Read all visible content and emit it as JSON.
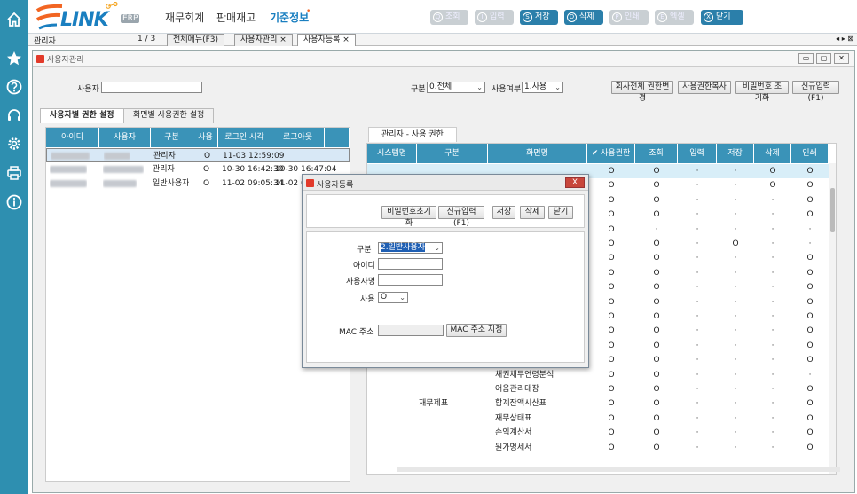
{
  "header": {
    "logo_text": "LINK",
    "logo_badge": "ERP",
    "menus": [
      "재무회계",
      "판매재고",
      "기준정보"
    ],
    "active_menu": "기준정보",
    "toolbar": [
      {
        "key": "Q",
        "label": "조회",
        "enabled": false
      },
      {
        "key": "I",
        "label": "입력",
        "enabled": false
      },
      {
        "key": "S",
        "label": "저장",
        "enabled": true
      },
      {
        "key": "D",
        "label": "삭제",
        "enabled": true
      },
      {
        "key": "P",
        "label": "인쇄",
        "enabled": false
      },
      {
        "key": "E",
        "label": "엑셀",
        "enabled": false
      },
      {
        "key": "X",
        "label": "닫기",
        "enabled": true
      }
    ]
  },
  "tabbar": {
    "user": "관리자",
    "page": "1 / 3",
    "tabs": [
      "전체메뉴(F3)",
      "사용자관리",
      "사용자등록"
    ],
    "close_glyph": "×",
    "nav": "◂ ▸ ⊠"
  },
  "window": {
    "title": "사용자관리",
    "controls": [
      "▭",
      "▢",
      "✕"
    ]
  },
  "filter": {
    "user_label": "사용자",
    "user_value": "",
    "group_label": "구분",
    "group_value": "0.전체",
    "use_label": "사용여부",
    "use_value": "1.사용",
    "btn_copy_all": "회사전체 권한변경",
    "btn_copy_perm": "사용권한복사",
    "btn_reset_pw": "비밀번호 초기화",
    "btn_new": "신규입력(F1)"
  },
  "subtabs": [
    "사용자별 권한 설정",
    "화면별 사용권한 설정"
  ],
  "left_grid": {
    "columns": [
      "아이디",
      "사용자",
      "구분",
      "사용",
      "로그인 시각",
      "로그아웃"
    ],
    "rows": [
      {
        "group": "관리자",
        "use": "O",
        "login": "11-03 12:59:09",
        "logout": "",
        "selected": true
      },
      {
        "group": "관리자",
        "use": "O",
        "login": "10-30 16:42:30",
        "logout": "10-30 16:47:04",
        "selected": false
      },
      {
        "group": "일반사용자",
        "use": "O",
        "login": "11-02 09:05:34",
        "logout": "11-02 09",
        "selected": false
      }
    ]
  },
  "right_panel": {
    "tab": "관리자 - 사용 권한",
    "columns": [
      "시스템명",
      "구분",
      "화면명",
      "✔ 사용권한",
      "조회",
      "입력",
      "저장",
      "삭제",
      "인쇄"
    ],
    "rows": [
      {
        "system": "",
        "group": "",
        "screen": "",
        "v": [
          "O",
          "O",
          "·",
          "·",
          "O",
          "O"
        ]
      },
      {
        "system": "",
        "group": "",
        "screen": "",
        "v": [
          "O",
          "O",
          "·",
          "·",
          "O",
          "O"
        ]
      },
      {
        "system": "",
        "group": "",
        "screen": "",
        "v": [
          "O",
          "O",
          "·",
          "·",
          "·",
          "O"
        ]
      },
      {
        "system": "",
        "group": "",
        "screen": "",
        "v": [
          "O",
          "O",
          "·",
          "·",
          "·",
          "O"
        ]
      },
      {
        "system": "",
        "group": "",
        "screen": "",
        "v": [
          "O",
          "·",
          "·",
          "·",
          "·",
          "·"
        ]
      },
      {
        "system": "",
        "group": "",
        "screen": "",
        "v": [
          "O",
          "O",
          "·",
          "O",
          "·",
          "·"
        ]
      },
      {
        "system": "",
        "group": "",
        "screen": "",
        "v": [
          "O",
          "O",
          "·",
          "·",
          "·",
          "O"
        ]
      },
      {
        "system": "",
        "group": "",
        "screen": "",
        "v": [
          "O",
          "O",
          "·",
          "·",
          "·",
          "O"
        ]
      },
      {
        "system": "",
        "group": "",
        "screen": "",
        "v": [
          "O",
          "O",
          "·",
          "·",
          "·",
          "O"
        ]
      },
      {
        "system": "",
        "group": "",
        "screen": "",
        "v": [
          "O",
          "O",
          "·",
          "·",
          "·",
          "O"
        ]
      },
      {
        "system": "",
        "group": "",
        "screen": "",
        "v": [
          "O",
          "O",
          "·",
          "·",
          "·",
          "O"
        ]
      },
      {
        "system": "",
        "group": "",
        "screen": "",
        "v": [
          "O",
          "O",
          "·",
          "·",
          "·",
          "O"
        ]
      },
      {
        "system": "",
        "group": "",
        "screen": "",
        "v": [
          "O",
          "O",
          "·",
          "·",
          "·",
          "O"
        ]
      },
      {
        "system": "",
        "group": "",
        "screen": "",
        "v": [
          "O",
          "O",
          "·",
          "·",
          "·",
          "O"
        ]
      },
      {
        "system": "",
        "group": "",
        "screen": "채권채무연령분석",
        "v": [
          "O",
          "O",
          "·",
          "·",
          "·",
          "·"
        ]
      },
      {
        "system": "",
        "group": "",
        "screen": "어음관리대장",
        "v": [
          "O",
          "O",
          "·",
          "·",
          "·",
          "O"
        ]
      },
      {
        "system": "",
        "group": "재무제표",
        "screen": "합계잔액시산표",
        "v": [
          "O",
          "O",
          "·",
          "·",
          "·",
          "O"
        ]
      },
      {
        "system": "",
        "group": "",
        "screen": "재무상태표",
        "v": [
          "O",
          "O",
          "·",
          "·",
          "·",
          "O"
        ]
      },
      {
        "system": "",
        "group": "",
        "screen": "손익계산서",
        "v": [
          "O",
          "O",
          "·",
          "·",
          "·",
          "O"
        ]
      },
      {
        "system": "",
        "group": "",
        "screen": "원가명세서",
        "v": [
          "O",
          "O",
          "·",
          "·",
          "·",
          "O"
        ]
      }
    ]
  },
  "dialog": {
    "title": "사용자등록",
    "close": "X",
    "btn_reset_pw": "비밀번호초기화",
    "btn_new": "신규입력(F1)",
    "btn_save": "저장",
    "btn_delete": "삭제",
    "btn_close": "닫기",
    "group_label": "구분",
    "group_value": "2.일반사용자",
    "id_label": "아이디",
    "id_value": "",
    "name_label": "사용자명",
    "name_value": "",
    "use_label": "사용",
    "use_value": "O",
    "mac_label": "MAC 주소",
    "mac_value": "",
    "btn_mac": "MAC 주소 지정"
  }
}
